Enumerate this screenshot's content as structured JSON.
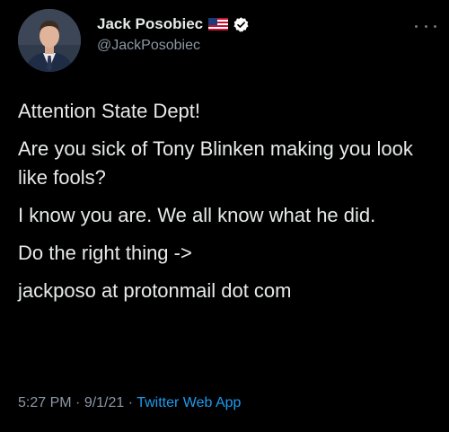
{
  "author": {
    "display_name": "Jack Posobiec",
    "handle": "@JackPosobiec",
    "flag_icon": "us-flag-icon",
    "verified_icon": "verified-badge-icon",
    "verified_color": "#ffffff"
  },
  "more_icon": "more-options-icon",
  "tweet": {
    "lines": [
      "Attention State Dept!",
      "Are you sick of Tony Blinken making you look like fools?",
      "I know you are. We all know what he did.",
      "Do the right thing ->",
      "jackposo at protonmail dot com"
    ]
  },
  "meta": {
    "time": "5:27 PM",
    "sep1": " · ",
    "date": "9/1/21",
    "sep2": " · ",
    "source": "Twitter Web App"
  },
  "colors": {
    "background": "#000000",
    "text": "#e7e9ea",
    "secondary": "#8b98a5",
    "link": "#1d9bf0"
  }
}
